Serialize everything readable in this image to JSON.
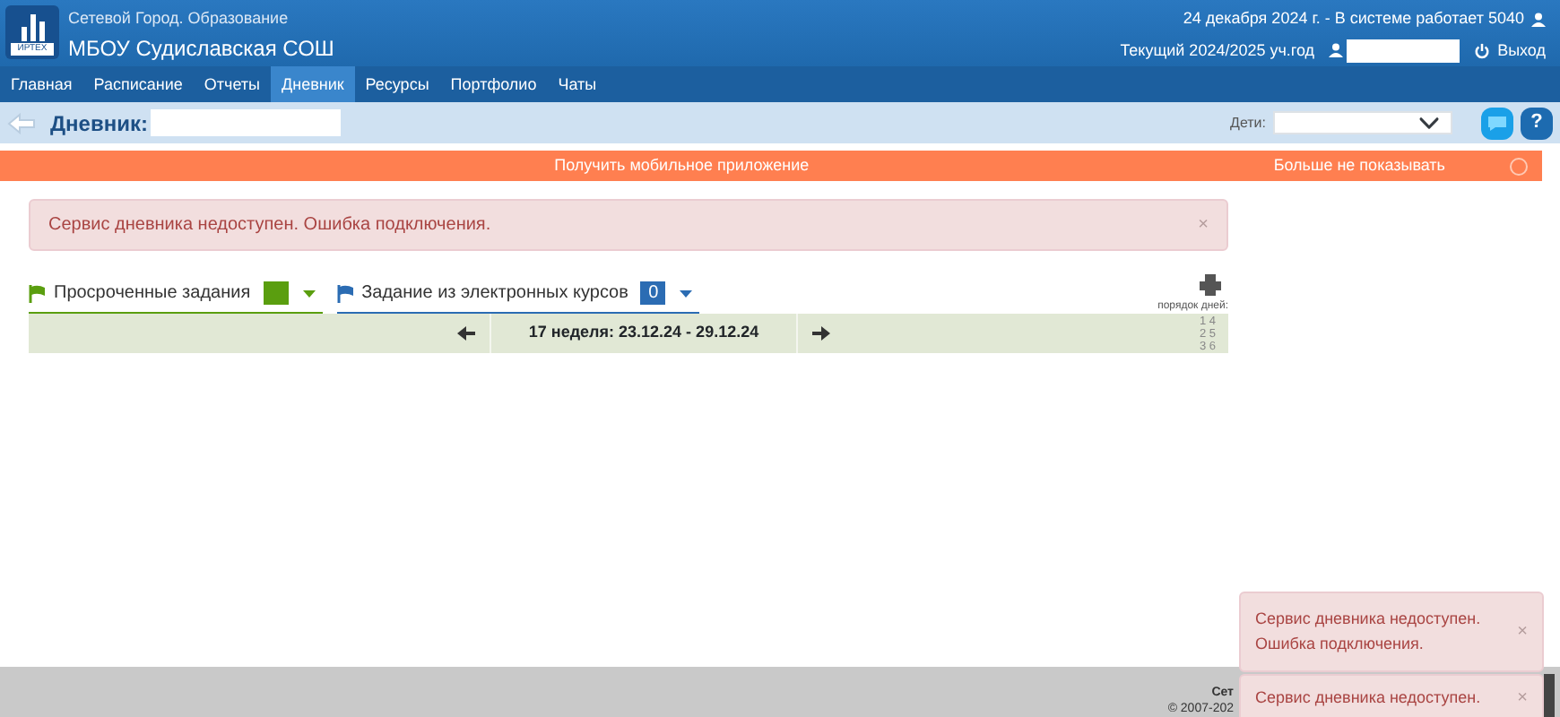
{
  "header": {
    "subtitle": "Сетевой Город. Образование",
    "school": "МБОУ Судиславская СОШ",
    "logo_text": "ИРТЕХ",
    "status": "24 декабря 2024 г. - В системе работает 5040",
    "year": "Текущий 2024/2025 уч.год",
    "logout": "Выход"
  },
  "nav": [
    {
      "label": "Главная",
      "selected": false
    },
    {
      "label": "Расписание",
      "selected": false
    },
    {
      "label": "Отчеты",
      "selected": false
    },
    {
      "label": "Дневник",
      "selected": true
    },
    {
      "label": "Ресурсы",
      "selected": false
    },
    {
      "label": "Портфолио",
      "selected": false
    },
    {
      "label": "Чаты",
      "selected": false
    }
  ],
  "subheader": {
    "title": "Дневник:",
    "children_label": "Дети:",
    "help": "?"
  },
  "banner": {
    "text": "Получить мобильное приложение",
    "dismiss": "Больше не показывать"
  },
  "alert": {
    "text": "Сервис дневника недоступен. Ошибка подключения.",
    "close": "×"
  },
  "filters": [
    {
      "label": "Просроченные задания",
      "color": "#5a9e0f"
    },
    {
      "label": "Задание из электронных курсов",
      "count": "0",
      "color": "#2b6cb3"
    }
  ],
  "week": {
    "label": "17 неделя: 23.12.24 - 29.12.24",
    "order_label": "порядок дней:",
    "order": [
      [
        "1",
        "4"
      ],
      [
        "2",
        "5"
      ],
      [
        "3",
        "6"
      ]
    ]
  },
  "footer": {
    "line_1": "Сет",
    "line_2": "© 2007-202"
  },
  "toasts": [
    {
      "text": "Сервис дневника недоступен. Ошибка подключения.",
      "close": "×"
    },
    {
      "text": "Сервис дневника недоступен.",
      "close": "×"
    }
  ]
}
